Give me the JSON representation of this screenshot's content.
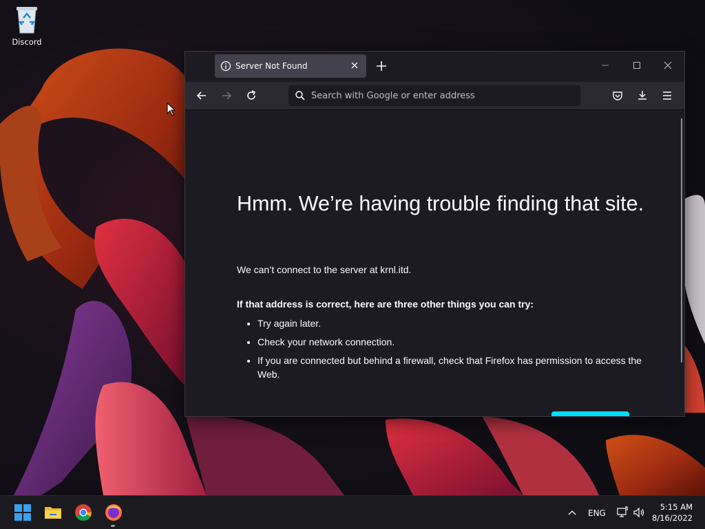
{
  "desktop": {
    "icons": [
      {
        "label": "Discord",
        "icon": "recycle-bin-icon"
      }
    ]
  },
  "browser": {
    "tab": {
      "title": "Server Not Found",
      "icon": "info-icon"
    },
    "urlbar": {
      "placeholder": "Search with Google or enter address"
    },
    "error": {
      "title": "Hmm. We’re having trouble finding that site.",
      "description": "We can’t connect to the server at krnl.itd.",
      "subtitle": "If that address is correct, here are three other things you can try:",
      "suggestions": [
        "Try again later.",
        "Check your network connection.",
        "If you are connected but behind a firewall, check that Firefox has permission to access the Web."
      ]
    },
    "colors": {
      "accent": "#00ddff",
      "background": "#1c1b22",
      "toolbar": "#2b2a33",
      "tab": "#42414d"
    }
  },
  "taskbar": {
    "apps": [
      "start-icon",
      "file-explorer-icon",
      "chrome-icon",
      "firefox-icon"
    ],
    "tray": {
      "language": "ENG"
    },
    "clock": {
      "time": "5:15 AM",
      "date": "8/16/2022"
    }
  }
}
